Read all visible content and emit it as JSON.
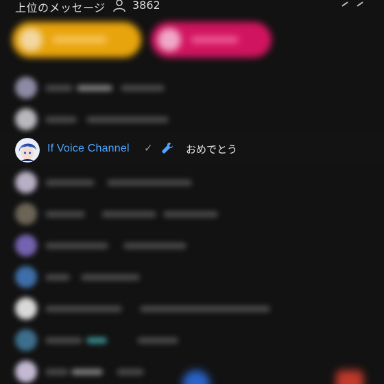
{
  "header": {
    "title": "上位のメッセージ",
    "viewer_count": "3862"
  },
  "highlighted_message": {
    "author": "If Voice Channel",
    "message": "おめでとう",
    "verified_icon": "check-icon",
    "badge_icon": "wrench-icon",
    "name_color": "#4ea5ff"
  },
  "chips": [
    {
      "color": "#e8a40c"
    },
    {
      "color": "#d1145f"
    }
  ],
  "blurred_rows": [
    {
      "avatar_color": "#8d8aa3"
    },
    {
      "avatar_color": "#b8b8bd"
    },
    {
      "avatar_color": "#b7b0c5"
    },
    {
      "avatar_color": "#6c6457"
    },
    {
      "avatar_color": "#7463b0"
    },
    {
      "avatar_color": "#3f6ea8"
    },
    {
      "avatar_color": "#d9d9d9"
    },
    {
      "avatar_color": "#3d6f8d"
    },
    {
      "avatar_color": "#c4b9d3"
    }
  ]
}
